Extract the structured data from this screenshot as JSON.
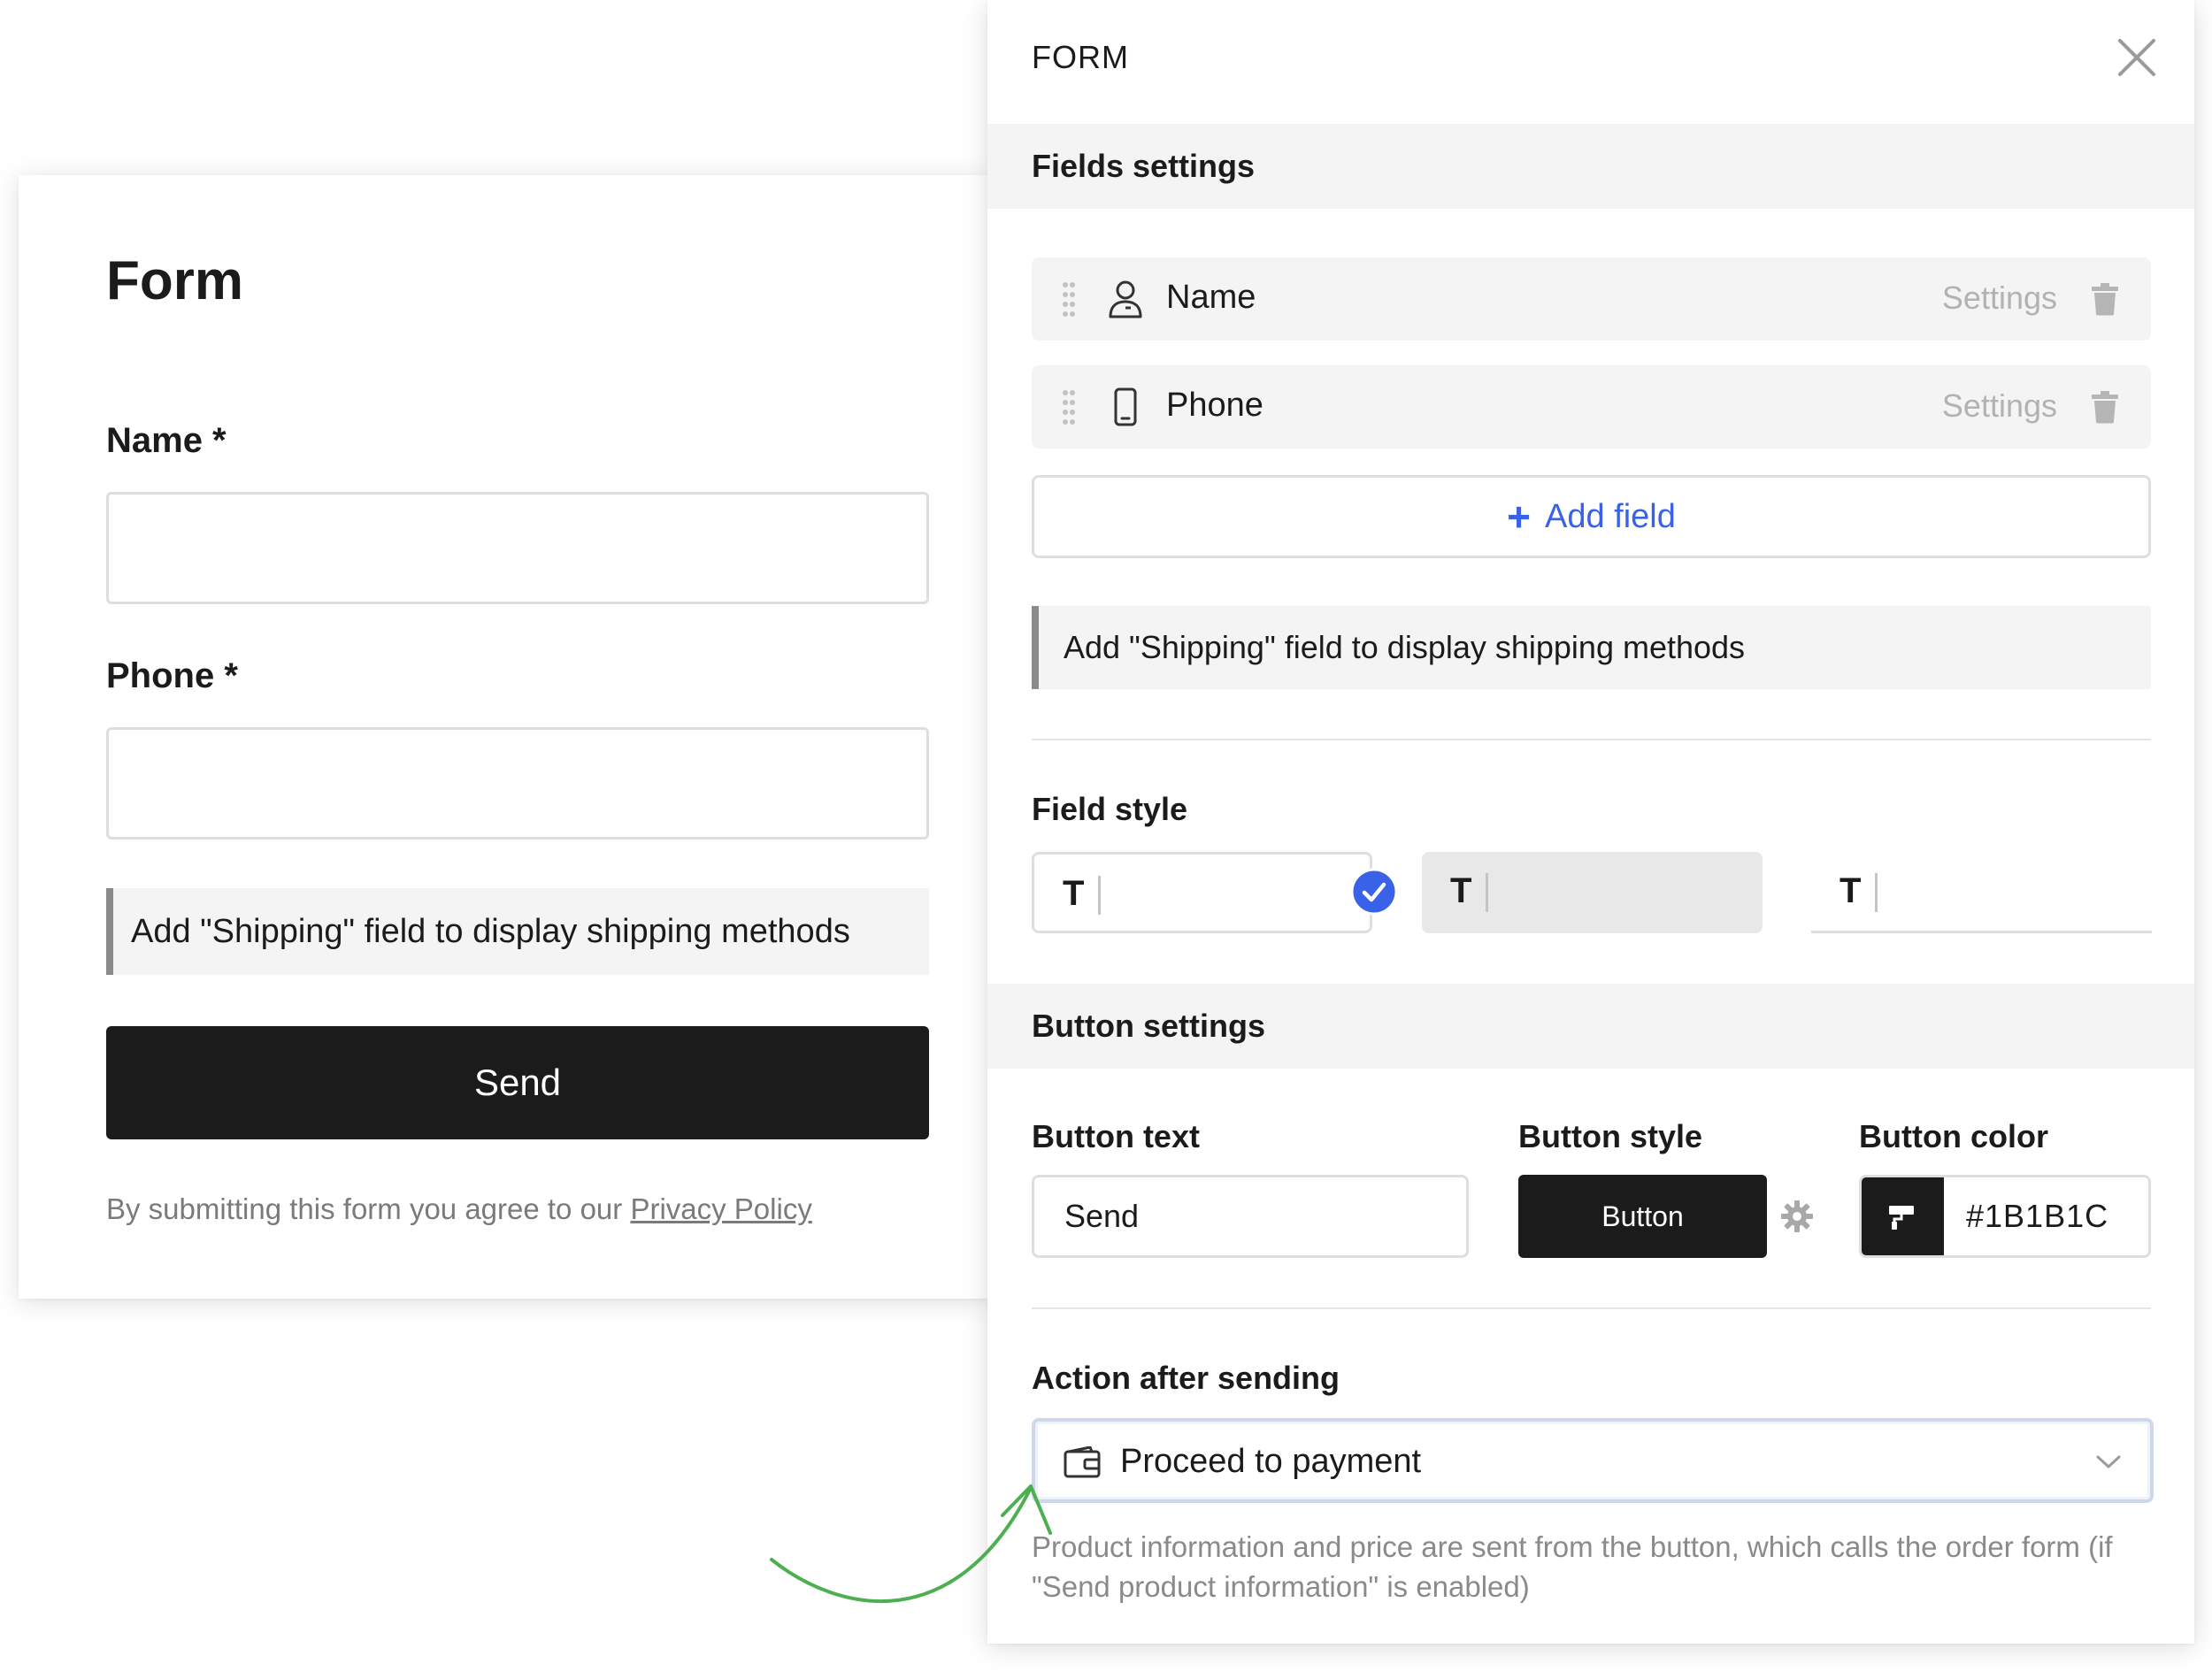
{
  "preview": {
    "title": "Form",
    "fields": [
      {
        "label": "Name *"
      },
      {
        "label": "Phone *"
      }
    ],
    "notice": "Add \"Shipping\" field to display shipping methods",
    "send_label": "Send",
    "consent_text": "By submitting this form you agree to our ",
    "privacy_link": "Privacy Policy"
  },
  "panel": {
    "title": "FORM",
    "fields_section": {
      "title": "Fields settings",
      "items": [
        {
          "name": "Name",
          "icon": "person-icon",
          "settings_label": "Settings"
        },
        {
          "name": "Phone",
          "icon": "phone-icon",
          "settings_label": "Settings"
        }
      ],
      "add_field_label": "Add field",
      "notice": "Add \"Shipping\" field to display shipping methods",
      "field_style": {
        "title": "Field style",
        "options": [
          {
            "glyph": "T",
            "style": "outline",
            "selected": true
          },
          {
            "glyph": "T",
            "style": "filled",
            "selected": false
          },
          {
            "glyph": "T",
            "style": "underline",
            "selected": false
          }
        ]
      }
    },
    "button_section": {
      "title": "Button settings",
      "button_text_label": "Button text",
      "button_text_value": "Send",
      "button_style_label": "Button style",
      "button_style_preview": "Button",
      "button_color_label": "Button color",
      "button_color_value": "#1B1B1C",
      "action_label": "Action after sending",
      "action_value": "Proceed to payment",
      "help_text": "Product information and price are sent from the button, which calls the order form (if \"Send product information\" is enabled)"
    }
  },
  "colors": {
    "dark": "#1b1b1c",
    "accent": "#3a62e8",
    "annotation_arrow": "#4caf50"
  }
}
